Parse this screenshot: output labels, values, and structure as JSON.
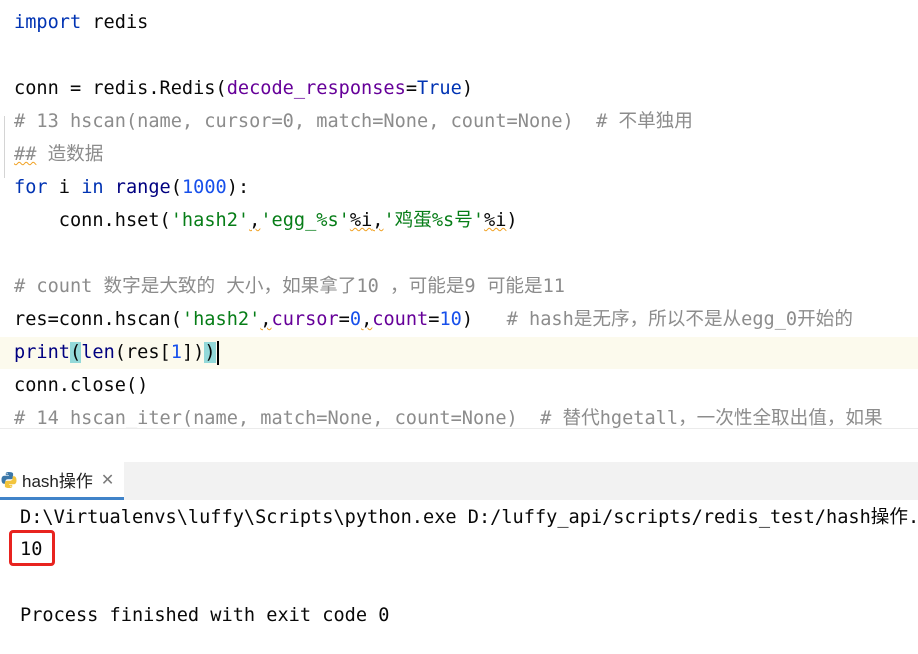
{
  "editor": {
    "lines": {
      "l1": {
        "kw": "import",
        "rest": " redis"
      },
      "l3": {
        "a": "conn = redis.Redis(",
        "param": "decode_responses",
        "eq": "=",
        "val": "True",
        "close": ")"
      },
      "l4": "# 13 hscan(name, cursor=0, match=None, count=None)  # 不单独用",
      "l5": {
        "hashes": "##",
        "text": " 造数据"
      },
      "l6": {
        "kw1": "for",
        "mid": " i ",
        "kw2": "in",
        "sp": " ",
        "builtin": "range",
        "open": "(",
        "num": "1000",
        "close": "):"
      },
      "l7": {
        "indent": "    conn.hset(",
        "s1": "'hash2'",
        "c1": ",",
        "s2": "'egg_%s'",
        "op1": "%i",
        "c2": ",",
        "s3": "'鸡蛋%s号'",
        "op2": "%i",
        "close": ")"
      },
      "l9": "# count 数字是大致的 大小，如果拿了10 ，可能是9 可能是11",
      "l10": {
        "a": "res=conn.hscan(",
        "s1": "'hash2'",
        "c1": ",",
        "p1": "cursor",
        "eq1": "=",
        "n1": "0",
        "c2": ",",
        "p2": "count",
        "eq2": "=",
        "n2": "10",
        "close": ")",
        "cmt": "   # hash是无序，所以不是从egg_0开始的"
      },
      "l11": {
        "b1": "print",
        "o1": "(",
        "b2": "len",
        "mid": "(res[",
        "num": "1",
        "close1": "])",
        "close2": ")"
      },
      "l12": "conn.close()",
      "l13": "# 14 hscan_iter(name, match=None, count=None)  # 替代hgetall，一次性全取出值，如果"
    }
  },
  "run_panel": {
    "tab_label": "hash操作",
    "close_glyph": "✕",
    "output": {
      "command": "D:\\Virtualenvs\\luffy\\Scripts\\python.exe D:/luffy_api/scripts/redis_test/hash操作.py",
      "result": "10",
      "exit": "Process finished with exit code 0"
    }
  },
  "colors": {
    "keyword": "#0033b3",
    "string": "#067d17",
    "number": "#1750eb",
    "param": "#660099",
    "comment": "#8c8c8c",
    "highlight_box": "#e8231f",
    "tab_underline": "#4083c9"
  },
  "icons": {
    "run_tab": "python-icon",
    "close": "close-icon"
  }
}
